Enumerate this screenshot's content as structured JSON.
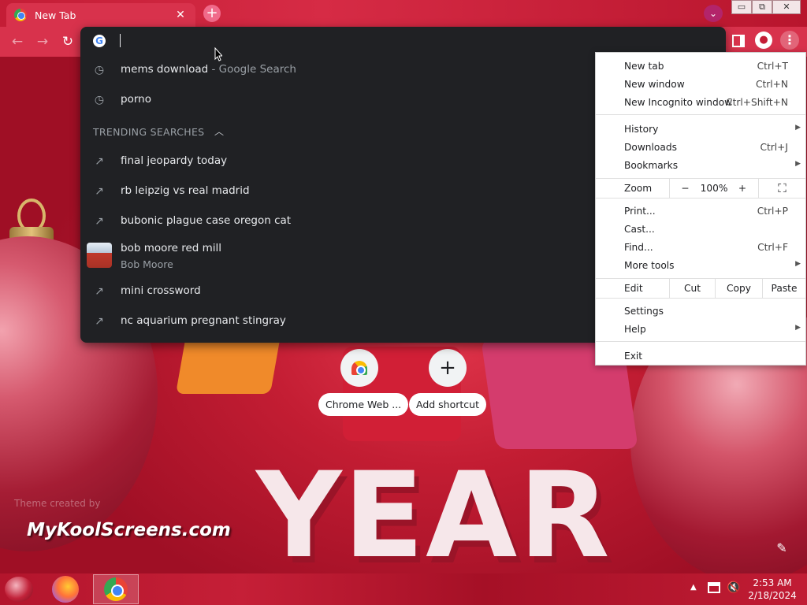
{
  "browser": {
    "tab_title": "New Tab",
    "tab_close": "✕",
    "new_tab": "+",
    "tab_search": "⌄",
    "window_min": "▭",
    "window_max": "⧉",
    "window_close": "✕",
    "omnibox_value": ""
  },
  "omnibox": {
    "recent": [
      {
        "text": "mems download",
        "sub": " - Google Search",
        "icon": "history-icon"
      },
      {
        "text": "porno",
        "sub": "",
        "icon": "history-icon"
      }
    ],
    "trending_header": "TRENDING SEARCHES",
    "trending": [
      {
        "text": "final jeopardy today",
        "icon": "trending-icon"
      },
      {
        "text": "rb leipzig vs real madrid",
        "icon": "trending-icon"
      },
      {
        "text": "bubonic plague case oregon cat",
        "icon": "trending-icon"
      },
      {
        "text": "bob moore red mill",
        "sub": "Bob Moore",
        "icon": "thumbnail"
      },
      {
        "text": "mini crossword",
        "icon": "trending-icon"
      },
      {
        "text": "nc aquarium pregnant stingray",
        "icon": "trending-icon"
      }
    ]
  },
  "menu": {
    "new_tab": {
      "label": "New tab",
      "shortcut": "Ctrl+T"
    },
    "new_window": {
      "label": "New window",
      "shortcut": "Ctrl+N"
    },
    "new_incognito": {
      "label": "New Incognito window",
      "shortcut": "Ctrl+Shift+N"
    },
    "history": {
      "label": "History"
    },
    "downloads": {
      "label": "Downloads",
      "shortcut": "Ctrl+J"
    },
    "bookmarks": {
      "label": "Bookmarks"
    },
    "zoom": {
      "label": "Zoom",
      "minus": "−",
      "value": "100%",
      "plus": "+",
      "fullscreen": "⛶"
    },
    "print": {
      "label": "Print...",
      "shortcut": "Ctrl+P"
    },
    "cast": {
      "label": "Cast..."
    },
    "find": {
      "label": "Find...",
      "shortcut": "Ctrl+F"
    },
    "more_tools": {
      "label": "More tools"
    },
    "edit": {
      "label": "Edit",
      "cut": "Cut",
      "copy": "Copy",
      "paste": "Paste"
    },
    "settings": {
      "label": "Settings"
    },
    "help": {
      "label": "Help"
    },
    "exit": {
      "label": "Exit"
    }
  },
  "shortcuts": [
    {
      "label": "Chrome Web ...",
      "icon": "chrome-web-store-icon"
    },
    {
      "label": "Add shortcut",
      "icon": "plus-icon"
    }
  ],
  "theme": {
    "credit": "Theme created by",
    "site": "MyKoolScreens.com",
    "big_word": "YEAR"
  },
  "taskbar": {
    "time": "2:53 AM",
    "date": "2/18/2024"
  },
  "colors": {
    "accent": "#d8324c",
    "omnibox_bg": "#202124"
  }
}
